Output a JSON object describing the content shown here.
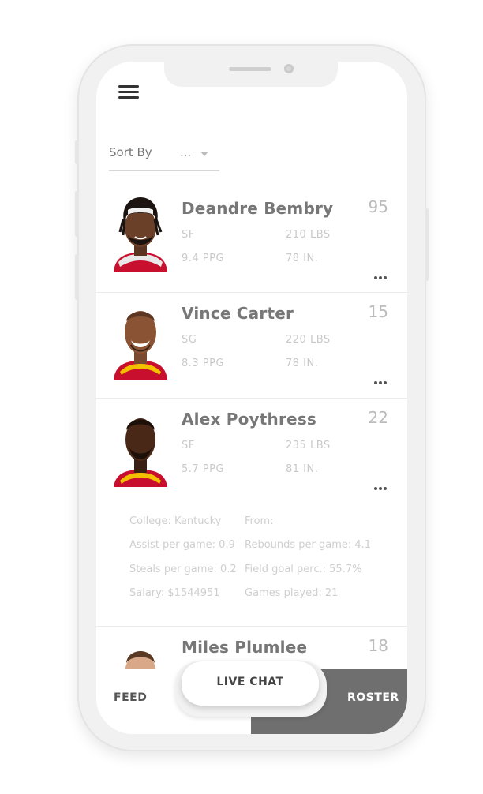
{
  "sort": {
    "label": "Sort By",
    "value": "..."
  },
  "players": [
    {
      "name": "Deandre Bembry",
      "number": "95",
      "position": "SF",
      "weight": "210 LBS",
      "ppg": "9.4 PPG",
      "height": "78 IN."
    },
    {
      "name": "Vince Carter",
      "number": "15",
      "position": "SG",
      "weight": "220 LBS",
      "ppg": "8.3 PPG",
      "height": "78 IN."
    },
    {
      "name": "Alex Poythress",
      "number": "22",
      "position": "SF",
      "weight": "235 LBS",
      "ppg": "5.7 PPG",
      "height": "81 IN.",
      "details": {
        "college": "College: Kentucky",
        "from": "From:",
        "assists": "Assist per game: 0.9",
        "rebounds": "Rebounds per game: 4.1",
        "steals": "Steals per game: 0.2",
        "fg": "Field goal perc.: 55.7%",
        "salary": "Salary: $1544951",
        "games": "Games played: 21"
      }
    },
    {
      "name": "Miles Plumlee",
      "number": "18"
    }
  ],
  "tabs": {
    "feed": "FEED",
    "live_chat": "LIVE CHAT",
    "roster": "ROSTER"
  },
  "colors": {
    "jersey_red": "#c8102e",
    "roster_tab": "#6f6f6f"
  }
}
